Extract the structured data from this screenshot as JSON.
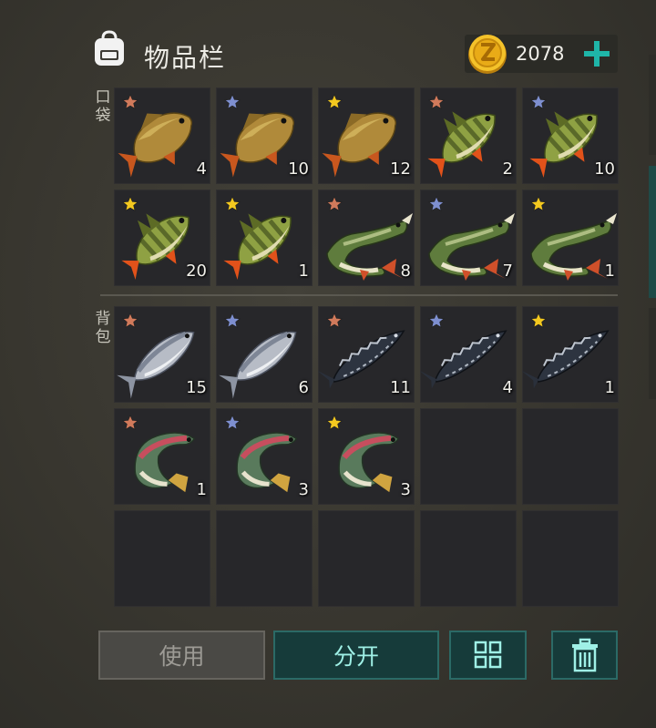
{
  "header": {
    "title": "物品栏"
  },
  "currency": {
    "amount": "2078"
  },
  "sections": {
    "pocket_label": "口袋",
    "backpack_label": "背包"
  },
  "star_colors": {
    "bronze": "#d17a5b",
    "silver": "#7e8fd0",
    "gold": "#f3c81f"
  },
  "pocket_items": [
    {
      "fish": "carp",
      "star": "bronze",
      "count": "4"
    },
    {
      "fish": "carp",
      "star": "silver",
      "count": "10"
    },
    {
      "fish": "carp",
      "star": "gold",
      "count": "12"
    },
    {
      "fish": "perch",
      "star": "bronze",
      "count": "2"
    },
    {
      "fish": "perch",
      "star": "silver",
      "count": "10"
    },
    {
      "fish": "perch",
      "star": "gold",
      "count": "20"
    },
    {
      "fish": "perch",
      "star": "gold",
      "count": "1"
    },
    {
      "fish": "pike",
      "star": "bronze",
      "count": "8"
    },
    {
      "fish": "pike",
      "star": "silver",
      "count": "7"
    },
    {
      "fish": "pike",
      "star": "gold",
      "count": "1"
    }
  ],
  "backpack_items": [
    {
      "fish": "salmon",
      "star": "bronze",
      "count": "15"
    },
    {
      "fish": "salmon",
      "star": "silver",
      "count": "6"
    },
    {
      "fish": "sturgeon",
      "star": "bronze",
      "count": "11"
    },
    {
      "fish": "sturgeon",
      "star": "silver",
      "count": "4"
    },
    {
      "fish": "sturgeon",
      "star": "gold",
      "count": "1"
    },
    {
      "fish": "trout",
      "star": "bronze",
      "count": "1"
    },
    {
      "fish": "trout",
      "star": "silver",
      "count": "3"
    },
    {
      "fish": "trout",
      "star": "gold",
      "count": "3"
    },
    null,
    null,
    null,
    null,
    null,
    null,
    null
  ],
  "buttons": {
    "use_label": "使用",
    "split_label": "分开",
    "sort_icon": "grid-sort-icon",
    "trash_icon": "trash-icon"
  }
}
